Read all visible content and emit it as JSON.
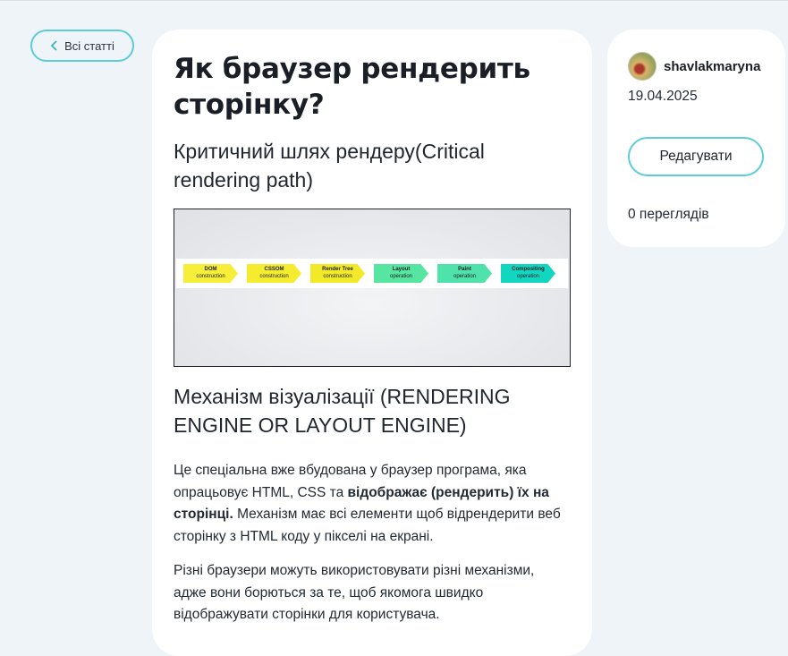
{
  "nav": {
    "back_label": "Всі статті",
    "back_icon": "chevron-left-icon"
  },
  "article": {
    "title": "Як браузер рендерить сторінку?",
    "subtitle": "Критичний шлях рендеру(Critical rendering path)",
    "image": {
      "stages": [
        {
          "name": "DOM",
          "sub": "construction",
          "color": "#f7ee3a"
        },
        {
          "name": "CSSOM",
          "sub": "construction",
          "color": "#f5ec2f"
        },
        {
          "name": "Render Tree",
          "sub": "construction",
          "color": "#f2ea29"
        },
        {
          "name": "Layout",
          "sub": "operation",
          "color": "#56e6a1"
        },
        {
          "name": "Paint",
          "sub": "operation",
          "color": "#4fe2ab"
        },
        {
          "name": "Compositing",
          "sub": "operation",
          "color": "#12d7c0"
        }
      ]
    },
    "section_heading": "Механізм візуалізації (RENDERING ENGINE OR LAYOUT ENGINE)",
    "paragraph1": {
      "part1": "Це спеціальна вже вбудована у браузер програма, яка опрацьовує HTML, CSS та ",
      "bold": "відображає (рендерить) їх на сторінці.",
      "part2": " Механізм має всі елементи щоб відрендерити веб сторінку з HTML коду у пікселі на екрані."
    },
    "paragraph2": "Різні браузери можуть використовувати різні механізми, адже вони борються за те, щоб якомога швидко відображувати сторінки для користувача."
  },
  "sidebar": {
    "author": "shavlakmaryna",
    "date": "19.04.2025",
    "edit_label": "Редагувати",
    "views": "0 переглядів"
  },
  "colors": {
    "accent": "#5ccbdc",
    "background": "#eef4f7",
    "card": "#ffffff"
  }
}
